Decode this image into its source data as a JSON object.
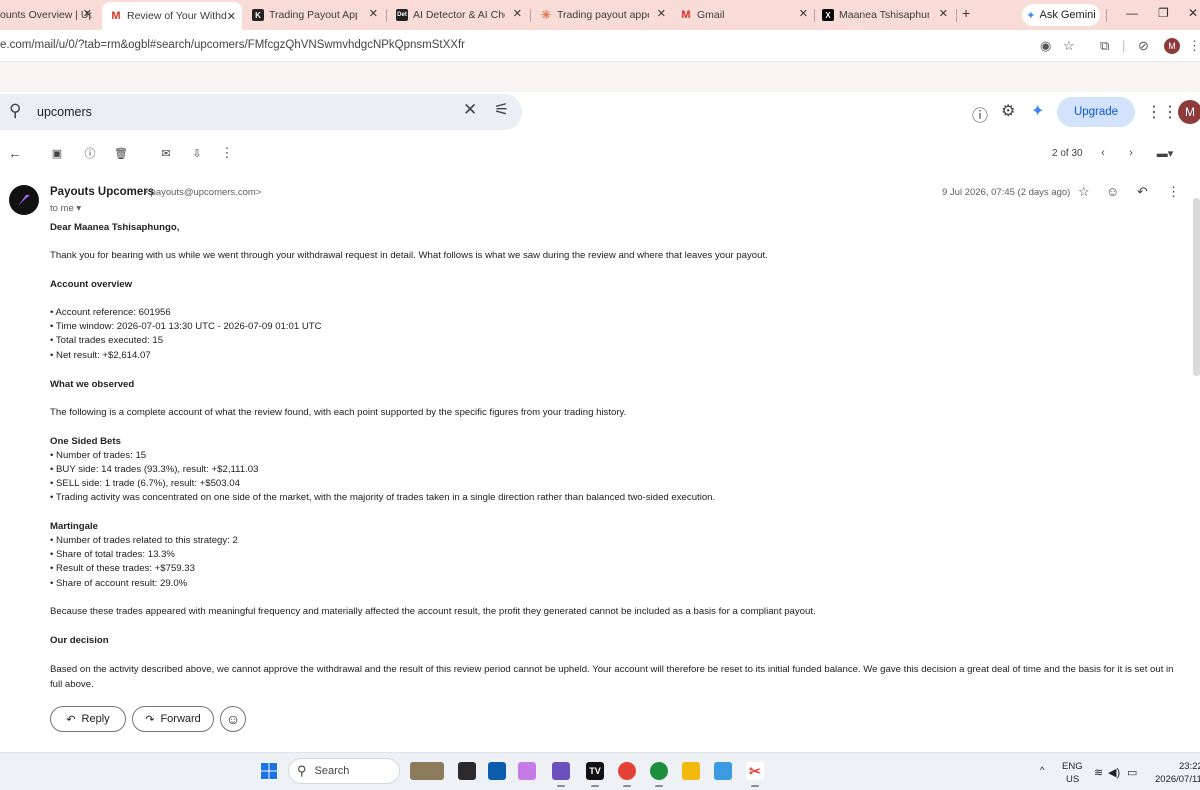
{
  "browser": {
    "tabs": [
      {
        "title": "ounts Overview | Up",
        "icon": "upcomers-icon"
      },
      {
        "title": "Review of Your Withdra",
        "icon": "gmail-icon"
      },
      {
        "title": "Trading Payout Appeal",
        "icon": "k-icon"
      },
      {
        "title": "AI Detector & AI Check",
        "icon": "ai-detector-icon"
      },
      {
        "title": "Trading payout appeal",
        "icon": "asterisk-icon"
      },
      {
        "title": "Gmail",
        "icon": "gmail-icon"
      },
      {
        "title": "Maanea Tshisaphungo",
        "icon": "x-icon"
      }
    ],
    "ask_gemini": "Ask Gemini",
    "url": "e.com/mail/u/0/?tab=rm&ogbl#search/upcomers/FMfcgzQhVNSwmvhdgcNPkQpnsmStXXfr",
    "profile_initial": "M"
  },
  "gmail": {
    "search_query": "upcomers",
    "upgrade_label": "Upgrade",
    "account_initial": "M",
    "pager": "2 of 30"
  },
  "message": {
    "sender_name": "Payouts Upcomers",
    "sender_email": "<payouts@upcomers.com>",
    "to": "to me",
    "date": "9 Jul 2026, 07:45 (2 days ago)",
    "greeting": "Dear Maanea Tshisaphungo,",
    "intro": "Thank you for bearing with us while we went through your withdrawal request in detail. What follows is what we saw during the review and where that leaves your payout.",
    "account_overview": {
      "heading": "Account overview",
      "items": [
        "• Account reference: 601956",
        "• Time window: 2026-07-01 13:30 UTC - 2026-07-09 01:01 UTC",
        "• Total trades executed: 15",
        "• Net result: +$2,614.07"
      ]
    },
    "observed": {
      "heading": "What we observed",
      "text": "The following is a complete account of what the review found, with each point supported by the specific figures from your trading history."
    },
    "one_sided": {
      "heading": "One Sided Bets",
      "items": [
        "• Number of trades: 15",
        "• BUY side: 14 trades (93.3%), result: +$2,111.03",
        "• SELL side: 1 trade (6.7%), result: +$503.04",
        "• Trading activity was concentrated on one side of the market, with the majority of trades taken in a single direction rather than balanced two-sided execution."
      ]
    },
    "martingale": {
      "heading": "Martingale",
      "items": [
        "• Number of trades related to this strategy: 2",
        "• Share of total trades: 13.3%",
        "• Result of these trades: +$759.33",
        "• Share of account result: 29.0%"
      ]
    },
    "frequency_note": "Because these trades appeared with meaningful frequency and materially affected the account result, the profit they generated cannot be included as a basis for a compliant payout.",
    "decision": {
      "heading": "Our decision",
      "text": "Based on the activity described above, we cannot approve the withdrawal and the result of this review period cannot be upheld. Your account will therefore be reset to its initial funded balance. We gave this decision a great deal of time and the basis for it is set out in full above."
    },
    "reply_label": "Reply",
    "forward_label": "Forward"
  },
  "taskbar": {
    "search_label": "Search",
    "lang_top": "ENG",
    "lang_bottom": "US",
    "time": "23:22",
    "date": "2026/07/11"
  }
}
